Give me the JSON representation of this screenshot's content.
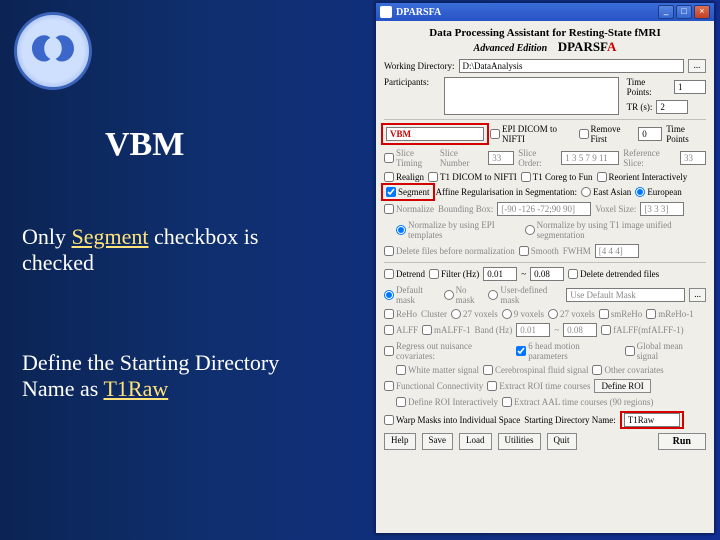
{
  "slide": {
    "title_main": "VBM",
    "note1_a": "Only ",
    "note1_seg": "Segment",
    "note1_b": " checkbox is",
    "note1_c": "checked",
    "note2_a": "Define the Starting Directory",
    "note2_b": "Name as ",
    "note2_hl": "T1Raw"
  },
  "win": {
    "title": "DPARSFA",
    "btn_min": "_",
    "btn_max": "□",
    "btn_close": "×",
    "header_line1": "Data Processing Assistant for Resting-State fMRI",
    "adv": "Advanced Edition",
    "pname_a": "DPARSF",
    "pname_b": "A",
    "workdir_lbl": "Working Directory:",
    "workdir_val": "D:\\DataAnalysis",
    "participants_lbl": "Participants:",
    "timepoints_lbl": "Time Points:",
    "timepoints_val": "1",
    "tr_lbl": "TR (s):",
    "tr_val": "2",
    "template_val": "VBM",
    "dots": "...",
    "epi2nifti": "EPI DICOM to NIFTI",
    "removefirst": "Remove First",
    "removefirst_val": "0",
    "removefirst_unit": "Time Points",
    "slicetiming": "Slice Timing",
    "slicenum_lbl": "Slice Number",
    "slicenum_val": "33",
    "sliceorder_lbl": "Slice Order:",
    "sliceorder_val": "1 3 5 7 9 11",
    "refslice_lbl": "Reference Slice:",
    "refslice_val": "33",
    "realign": "Realign",
    "t1dicom": "T1 DICOM to NIFTI",
    "t1coreg": "T1 Coreg to Fun",
    "reorient": "Reorient Interactively",
    "segment": "Segment",
    "affine": "Affine Regularisation in Segmentation:",
    "eastasian": "East Asian",
    "european": "European",
    "normalize": "Normalize",
    "bbox_lbl": "Bounding Box:",
    "bbox_val": "[-90 -126 -72;90 90]",
    "voxsize_lbl": "Voxel Size:",
    "voxsize_val": "[3 3 3]",
    "norm_epi": "Normalize by using EPI templates",
    "norm_t1": "Normalize by using T1 image unified segmentation",
    "delete_pre": "Delete files before normalization",
    "smooth": "Smooth",
    "fwhm_lbl": "FWHM",
    "fwhm_val": "[4 4 4]",
    "detrend": "Detrend",
    "filter": "Filter (Hz)",
    "filt_lo": "0.01",
    "filt_tilde": "~",
    "filt_hi": "0.08",
    "del_det": "Delete detrended files",
    "defmask": "Default mask",
    "nomask": "No mask",
    "usermask": "User-defined mask",
    "usedef": "Use Default Mask",
    "reho": "ReHo",
    "cluster": "Cluster",
    "c27": "27 voxels",
    "c9": "9 voxels",
    "c27b": "27 voxels",
    "smreho": "smReHo",
    "mreho": "mReHo-1",
    "alff": "ALFF",
    "malff": "mALFF-1",
    "band_lbl": "Band (Hz)",
    "band_lo": "0.01",
    "band_hi": "0.08",
    "falff": "fALFF(mfALFF-1)",
    "regress": "Regress out nuisance covariates:",
    "headmotion": "6 head motion parameters",
    "global": "Global mean signal",
    "wm": "White matter signal",
    "csf": "Cerebrospinal fluid signal",
    "othercov": "Other covariates",
    "fc": "Functional Connectivity",
    "extract": "Extract ROI time courses",
    "defroi": "Define ROI",
    "defroi_int": "Define ROI Interactively",
    "extractAAL": "Extract AAL time courses (90 regions)",
    "warp": "Warp Masks into Individual Space",
    "start_lbl": "Starting Directory Name:",
    "start_val": "T1Raw",
    "help": "Help",
    "save": "Save",
    "load": "Load",
    "util": "Utilities",
    "quit": "Quit",
    "run": "Run"
  }
}
